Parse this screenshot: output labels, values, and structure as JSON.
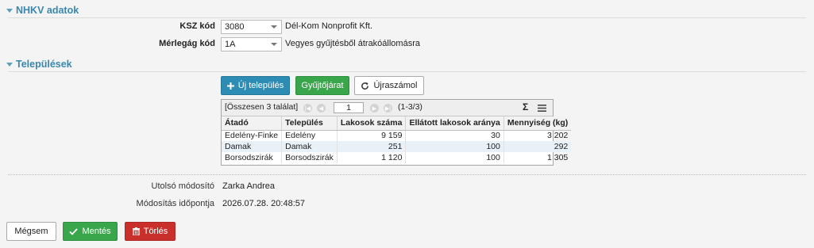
{
  "nhkv": {
    "title": "NHKV adatok",
    "ksz_label": "KSZ kód",
    "ksz_value": "3080",
    "ksz_desc": "Dél-Kom Nonprofit Kft.",
    "merleg_label": "Mérlegág kód",
    "merleg_value": "1A",
    "merleg_desc": "Vegyes gyűjtésből átrakóállomásra"
  },
  "telepulesek": {
    "title": "Települések",
    "btn_new": "Új település",
    "btn_gyujto": "Gyűjtőjárat",
    "btn_recalc": "Újraszámol"
  },
  "grid": {
    "total": "[Összesen 3 találat]",
    "page": "1",
    "range": "(1-3/3)",
    "sigma": "Σ",
    "columns": [
      "Átadó",
      "Település",
      "Lakosok száma",
      "Ellátott lakosok aránya",
      "Mennyiség (kg)"
    ],
    "rows": [
      [
        "Edelény-Finke",
        "Edelény",
        "9 159",
        "30",
        "3 202"
      ],
      [
        "Damak",
        "Damak",
        "251",
        "100",
        "292"
      ],
      [
        "Borsodszirák",
        "Borsodszirák",
        "1 120",
        "100",
        "1 305"
      ]
    ]
  },
  "meta": {
    "modifier_label": "Utolsó módosító",
    "modifier_value": "Zarka Andrea",
    "modtime_label": "Módosítás időpontja",
    "modtime_value": "2026.07.28. 20:48:57"
  },
  "actions": {
    "cancel": "Mégsem",
    "save": "Mentés",
    "delete": "Törlés"
  },
  "colors": {
    "accent": "#3a87ad",
    "primary": "#2c8cb3",
    "success": "#3aa64c",
    "danger": "#c9302c"
  }
}
